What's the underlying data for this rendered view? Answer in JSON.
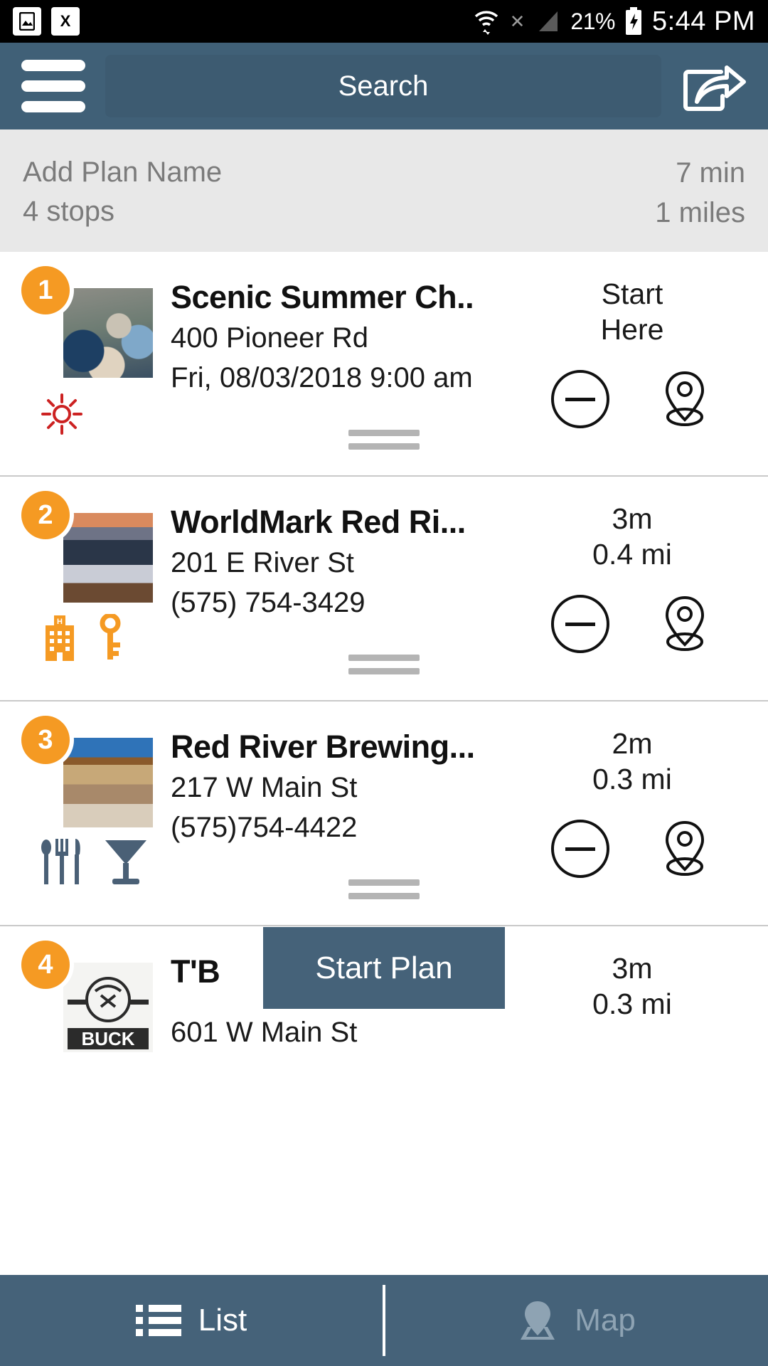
{
  "status_bar": {
    "icons": [
      "image-saved-icon",
      "sim-card-x-icon",
      "wifi-icon",
      "signal-x-icon",
      "cellular-signal-icon",
      "battery-charging-icon"
    ],
    "battery_percent": "21%",
    "time": "5:44 PM"
  },
  "header": {
    "menu_icon": "hamburger-menu-icon",
    "search_placeholder": "Search",
    "share_icon": "share-icon"
  },
  "plan_summary": {
    "plan_name": "Add Plan Name",
    "stops": "4 stops",
    "duration": "7 min",
    "distance": "1 miles"
  },
  "stops": [
    {
      "number": "1",
      "title": "Scenic Summer Ch..",
      "address": "400 Pioneer Rd",
      "detail": "Fri, 08/03/2018 9:00 am",
      "eta_primary": "Start",
      "eta_secondary": "Here",
      "categories": [
        "sun-icon"
      ],
      "thumb_class": "th-crowd",
      "remove_icon": "minus-circle-icon",
      "map_icon": "map-pin-icon"
    },
    {
      "number": "2",
      "title": "WorldMark Red Ri...",
      "address": "201 E River St",
      "detail": "(575) 754-3429",
      "eta_primary": "3m",
      "eta_secondary": "0.4 mi",
      "categories": [
        "hotel-icon",
        "key-icon"
      ],
      "thumb_class": "th-lodge",
      "remove_icon": "minus-circle-icon",
      "map_icon": "map-pin-icon"
    },
    {
      "number": "3",
      "title": "Red River Brewing...",
      "address": "217 W Main St",
      "detail": "(575)754-4422",
      "eta_primary": "2m",
      "eta_secondary": "0.3 mi",
      "categories": [
        "restaurant-icon",
        "cocktail-icon"
      ],
      "thumb_class": "th-brew",
      "remove_icon": "minus-circle-icon",
      "map_icon": "map-pin-icon"
    },
    {
      "number": "4",
      "title": "T'B",
      "address": "601 W Main St",
      "detail": "",
      "eta_primary": "3m",
      "eta_secondary": "0.3 mi",
      "categories": [],
      "thumb_class": "th-logo",
      "remove_icon": "minus-circle-icon",
      "map_icon": "map-pin-icon"
    }
  ],
  "start_plan": {
    "label": "Start Plan"
  },
  "bottom_nav": {
    "tabs": [
      {
        "label": "List",
        "icon": "list-icon",
        "active": true
      },
      {
        "label": "Map",
        "icon": "map-pin-icon",
        "active": false
      }
    ]
  },
  "colors": {
    "header_bg": "#406077",
    "accent_orange": "#f59a23",
    "summary_bg": "#e8e8e8",
    "sun_red": "#cc2222",
    "restaurant_slate": "#4a6076"
  }
}
